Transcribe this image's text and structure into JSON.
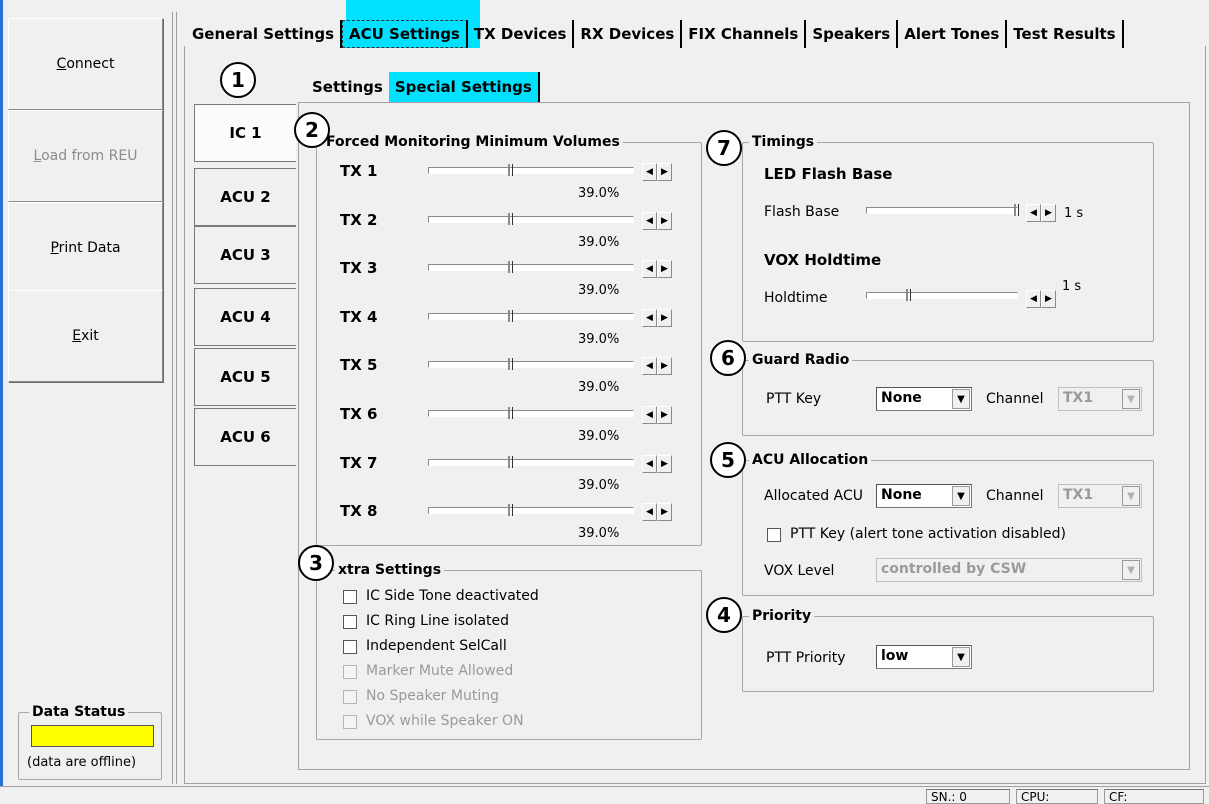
{
  "left_buttons": {
    "connect": "Connect",
    "load": "Load from REU",
    "print": "Print Data",
    "exit": "Exit"
  },
  "data_status": {
    "title": "Data Status",
    "text": "(data are offline)",
    "color": "#ffff00"
  },
  "tabs": [
    "General Settings",
    "ACU Settings",
    "TX Devices",
    "RX Devices",
    "FIX Channels",
    "Speakers",
    "Alert Tones",
    "Test Results"
  ],
  "subtabs": [
    "Settings",
    "Special Settings"
  ],
  "sidetabs": [
    "IC 1",
    "ACU 2",
    "ACU 3",
    "ACU 4",
    "ACU 5",
    "ACU 6"
  ],
  "callouts": [
    "1",
    "2",
    "3",
    "4",
    "5",
    "6",
    "7"
  ],
  "forced_monitoring": {
    "title": "Forced Monitoring Minimum Volumes",
    "rows": [
      {
        "label": "TX 1",
        "value": "39.0%"
      },
      {
        "label": "TX 2",
        "value": "39.0%"
      },
      {
        "label": "TX 3",
        "value": "39.0%"
      },
      {
        "label": "TX 4",
        "value": "39.0%"
      },
      {
        "label": "TX 5",
        "value": "39.0%"
      },
      {
        "label": "TX 6",
        "value": "39.0%"
      },
      {
        "label": "TX 7",
        "value": "39.0%"
      },
      {
        "label": "TX 8",
        "value": "39.0%"
      }
    ],
    "level_fraction": 0.39
  },
  "extra_settings": {
    "title": "xtra Settings",
    "items": [
      {
        "label": "IC Side Tone deactivated",
        "disabled": false
      },
      {
        "label": "IC Ring Line isolated",
        "disabled": false
      },
      {
        "label": "Independent SelCall",
        "disabled": false
      },
      {
        "label": "Marker Mute Allowed",
        "disabled": true
      },
      {
        "label": "No Speaker Muting",
        "disabled": true
      },
      {
        "label": "VOX while Speaker ON",
        "disabled": true
      }
    ]
  },
  "timings": {
    "title": "Timings",
    "led_title": "LED Flash Base",
    "flash_label": "Flash Base",
    "flash_value": "1 s",
    "vox_title": "VOX Holdtime",
    "hold_label": "Holdtime",
    "hold_value": "1 s"
  },
  "guard_radio": {
    "title": "Guard Radio",
    "ptt_label": "PTT Key",
    "ptt_value": "None",
    "channel_label": "Channel",
    "channel_value": "TX1"
  },
  "acu_allocation": {
    "title": "ACU Allocation",
    "allocated_label": "Allocated ACU",
    "allocated_value": "None",
    "channel_label": "Channel",
    "channel_value": "TX1",
    "ptt_check_label": "PTT Key (alert tone activation disabled)",
    "vox_label": "VOX Level",
    "vox_value": "controlled by CSW"
  },
  "priority": {
    "title": "Priority",
    "label": "PTT Priority",
    "value": "low"
  },
  "statusbar": {
    "sn": "SN.: 0",
    "cpu": "CPU:",
    "cf": "CF:"
  },
  "colors": {
    "highlight": "#00e0ff",
    "window_accent": "#2b6fd6"
  }
}
